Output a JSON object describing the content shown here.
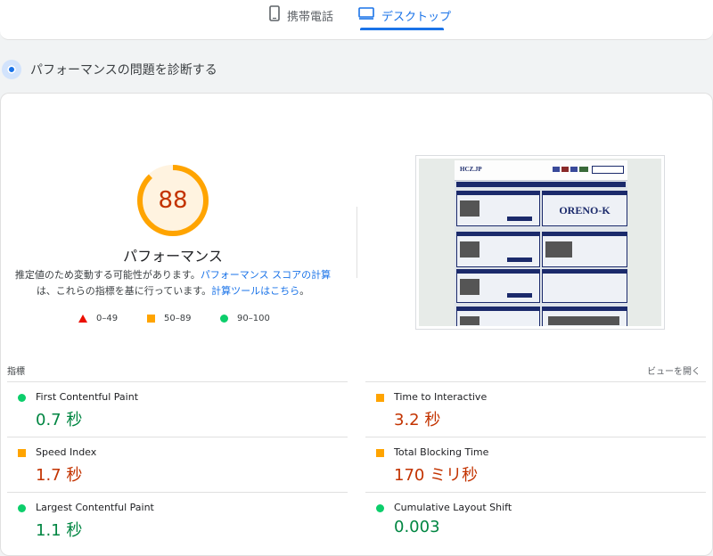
{
  "tabs": {
    "mobile": {
      "label": "携帯電話",
      "icon": "phone-icon"
    },
    "desktop": {
      "label": "デスクトップ",
      "icon": "monitor-icon",
      "selected": true
    }
  },
  "section": {
    "title": "パフォーマンスの問題を診断する",
    "icon": "diagnose-icon"
  },
  "gauge": {
    "score": "88",
    "score_fraction": 0.88,
    "label": "パフォーマンス",
    "desc_part1": "推定値のため変動する可能性があります。",
    "desc_link1": "パフォーマンス スコアの計算",
    "desc_part2": "は、これらの指標を基に行っています。",
    "desc_link2": "計算ツールはこちら",
    "desc_end": "。",
    "color": "#ffa400"
  },
  "legend": [
    {
      "shape": "triangle",
      "range": "0–49",
      "color": "#eb0f00"
    },
    {
      "shape": "square",
      "range": "50–89",
      "color": "#ffa400"
    },
    {
      "shape": "circle",
      "range": "90–100",
      "color": "#0cce6b"
    }
  ],
  "thumbnail": {
    "site_logo": "HCZ.JP",
    "headline": "ORENO-K"
  },
  "metrics": {
    "header": "指標",
    "expand_label": "ビューを開く",
    "items": [
      {
        "name": "First Contentful Paint",
        "value": "0.7 秒",
        "status": "good"
      },
      {
        "name": "Time to Interactive",
        "value": "3.2 秒",
        "status": "average"
      },
      {
        "name": "Speed Index",
        "value": "1.7 秒",
        "status": "average"
      },
      {
        "name": "Total Blocking Time",
        "value": "170 ミリ秒",
        "status": "average"
      },
      {
        "name": "Largest Contentful Paint",
        "value": "1.1 秒",
        "status": "good"
      },
      {
        "name": "Cumulative Layout Shift",
        "value": "0.003",
        "status": "good"
      }
    ]
  }
}
